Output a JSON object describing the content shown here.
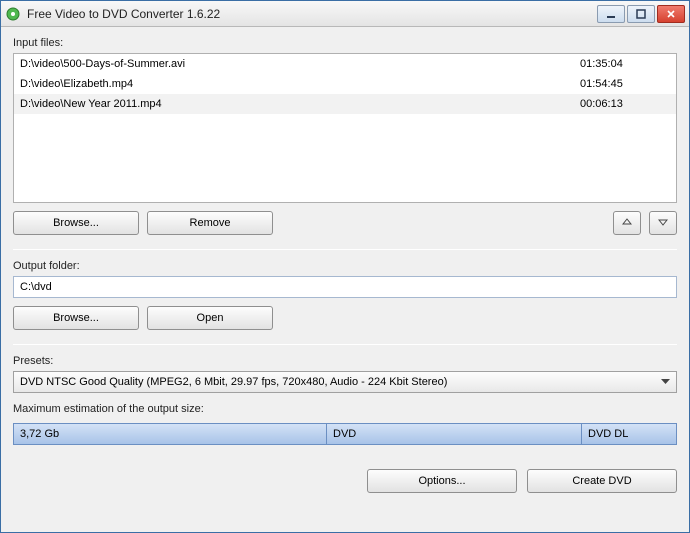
{
  "window": {
    "title": "Free Video to DVD Converter 1.6.22"
  },
  "labels": {
    "input_files": "Input files:",
    "output_folder": "Output folder:",
    "presets": "Presets:",
    "max_estimation": "Maximum estimation of the output size:"
  },
  "files": [
    {
      "path": "D:\\video\\500-Days-of-Summer.avi",
      "duration": "01:35:04"
    },
    {
      "path": "D:\\video\\Elizabeth.mp4",
      "duration": "01:54:45"
    },
    {
      "path": "D:\\video\\New Year 2011.mp4",
      "duration": "00:06:13"
    }
  ],
  "buttons": {
    "browse": "Browse...",
    "remove": "Remove",
    "open": "Open",
    "options": "Options...",
    "create_dvd": "Create DVD"
  },
  "output": {
    "path": "C:\\dvd"
  },
  "preset": {
    "selected": "DVD NTSC Good Quality (MPEG2, 6 Mbit, 29.97 fps, 720x480, Audio - 224 Kbit Stereo)"
  },
  "size_bar": {
    "size": "3,72 Gb",
    "dvd": "DVD",
    "dvd_dl": "DVD DL"
  }
}
